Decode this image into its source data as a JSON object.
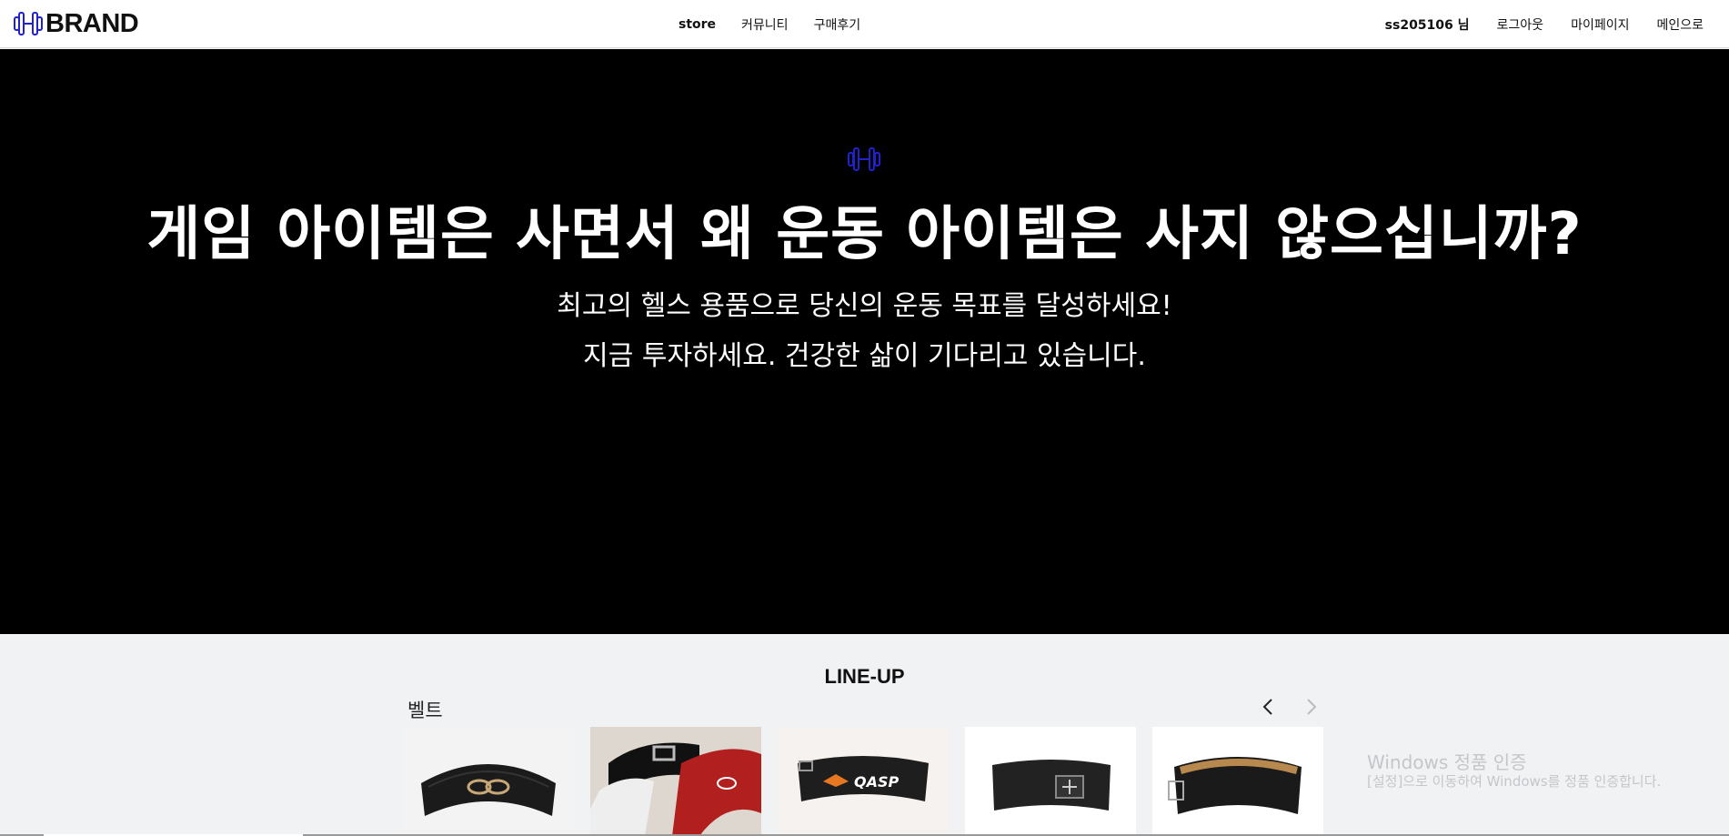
{
  "nav": {
    "logo_text": "BRAND",
    "center_items": [
      "store",
      "커뮤니티",
      "구매후기"
    ],
    "user_label": "ss205106 님",
    "logout_label": "로그아웃",
    "mypage_label": "마이페이지",
    "main_label": "메인으로"
  },
  "hero": {
    "title": "게임 아이템은 사면서 왜 운동 아이템은 사지 않으십니까?",
    "subtitle_line1": "최고의 헬스 용품으로 당신의 운동 목표를 달성하세요!",
    "subtitle_line2": "지금 투자하세요. 건강한 삶이 기다리고 있습니다."
  },
  "lineup": {
    "title": "LINE-UP",
    "category": "벨트",
    "products": [
      {
        "name": "belt-1"
      },
      {
        "name": "belt-2"
      },
      {
        "name": "belt-3"
      },
      {
        "name": "belt-4"
      },
      {
        "name": "belt-5"
      }
    ]
  },
  "watermark": {
    "line1": "Windows 정품 인증",
    "line2": "[설정]으로 이동하여 Windows를 정품 인증합니다."
  },
  "colors": {
    "accent": "#2222cc",
    "hero_bg": "#000000",
    "section_bg": "#f1f2f4"
  }
}
